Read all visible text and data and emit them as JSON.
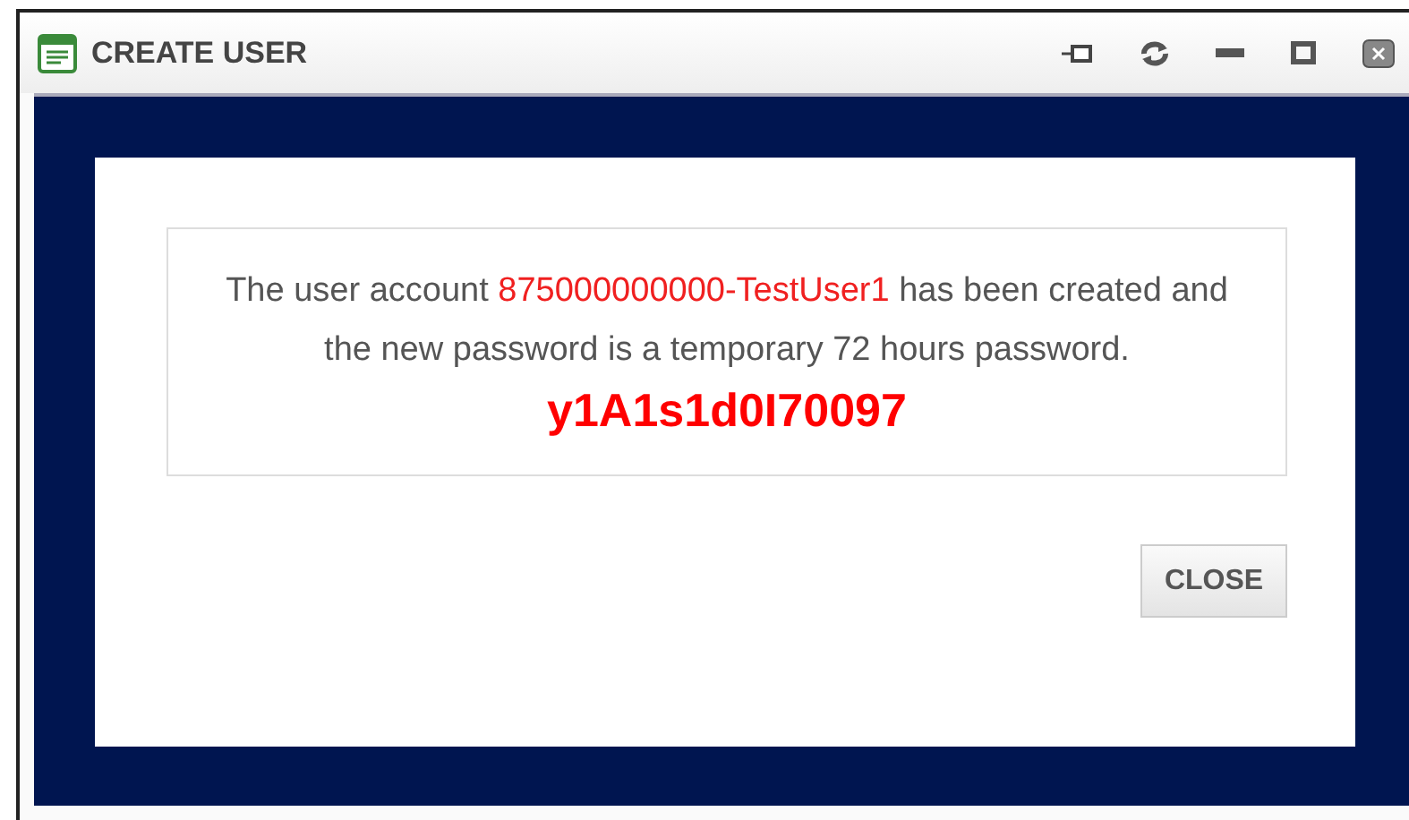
{
  "window": {
    "title": "CREATE USER"
  },
  "message": {
    "before": "The user account ",
    "account": "875000000000-TestUser1",
    "after": " has been created and the new password is a temporary 72 hours password."
  },
  "password": "y1A1s1d0I70097",
  "buttons": [
    {
      "label": "CLOSE"
    }
  ]
}
